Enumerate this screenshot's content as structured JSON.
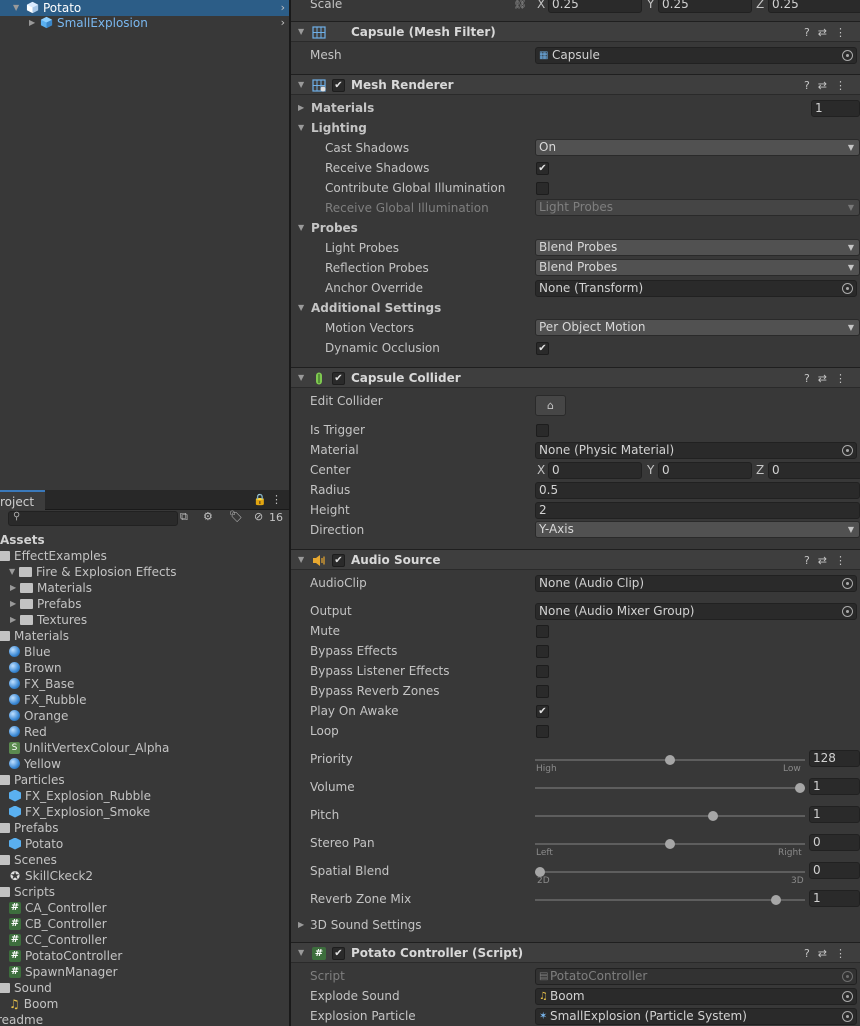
{
  "hierarchy": {
    "items": [
      {
        "label": "Potato",
        "selected": true
      },
      {
        "label": "SmallExplosion",
        "selected": false
      }
    ]
  },
  "project": {
    "tab_label": "roject",
    "hidden_count": "16",
    "search_placeholder": "",
    "assets_root": "Assets",
    "tree": [
      {
        "label": "EffectExamples",
        "icon": "folder-icon",
        "indent": 0,
        "expanded": true
      },
      {
        "label": "Fire & Explosion Effects",
        "icon": "folder-icon",
        "indent": 1,
        "expanded": true
      },
      {
        "label": "Materials",
        "icon": "folder-icon",
        "indent": 2,
        "expanded": false
      },
      {
        "label": "Prefabs",
        "icon": "folder-icon",
        "indent": 2,
        "expanded": false
      },
      {
        "label": "Textures",
        "icon": "folder-icon",
        "indent": 2,
        "expanded": false
      },
      {
        "label": "Materials",
        "icon": "folder-icon",
        "indent": 0,
        "expanded": true
      },
      {
        "label": "Blue",
        "icon": "material-icon",
        "indent": 1
      },
      {
        "label": "Brown",
        "icon": "material-icon",
        "indent": 1
      },
      {
        "label": "FX_Base",
        "icon": "material-icon",
        "indent": 1
      },
      {
        "label": "FX_Rubble",
        "icon": "material-icon",
        "indent": 1
      },
      {
        "label": "Orange",
        "icon": "material-icon",
        "indent": 1
      },
      {
        "label": "Red",
        "icon": "material-icon",
        "indent": 1
      },
      {
        "label": "UnlitVertexColour_Alpha",
        "icon": "shader-icon",
        "indent": 1
      },
      {
        "label": "Yellow",
        "icon": "material-icon",
        "indent": 1
      },
      {
        "label": "Particles",
        "icon": "folder-icon",
        "indent": 0,
        "expanded": true
      },
      {
        "label": "FX_Explosion_Rubble",
        "icon": "prefab-icon",
        "indent": 1
      },
      {
        "label": "FX_Explosion_Smoke",
        "icon": "prefab-icon",
        "indent": 1
      },
      {
        "label": "Prefabs",
        "icon": "folder-icon",
        "indent": 0,
        "expanded": true
      },
      {
        "label": "Potato",
        "icon": "prefab-icon",
        "indent": 1
      },
      {
        "label": "Scenes",
        "icon": "folder-icon",
        "indent": 0,
        "expanded": true
      },
      {
        "label": "SkillCkeck2",
        "icon": "scene-icon",
        "indent": 1
      },
      {
        "label": "Scripts",
        "icon": "folder-icon",
        "indent": 0,
        "expanded": true
      },
      {
        "label": "CA_Controller",
        "icon": "script-icon",
        "indent": 1
      },
      {
        "label": "CB_Controller",
        "icon": "script-icon",
        "indent": 1
      },
      {
        "label": "CC_Controller",
        "icon": "script-icon",
        "indent": 1
      },
      {
        "label": "PotatoController",
        "icon": "script-icon",
        "indent": 1
      },
      {
        "label": "SpawnManager",
        "icon": "script-icon",
        "indent": 1
      },
      {
        "label": "Sound",
        "icon": "folder-icon",
        "indent": 0,
        "expanded": true
      },
      {
        "label": "Boom",
        "icon": "audio-icon",
        "indent": 1
      },
      {
        "label": "readme",
        "icon": "none",
        "indent": 0
      }
    ]
  },
  "inspector": {
    "scale": {
      "label": "Scale",
      "x": "0.25",
      "y": "0.25",
      "z": "0.25",
      "ax": "X",
      "ay": "Y",
      "az": "Z"
    },
    "mesh_filter": {
      "title": "Capsule (Mesh Filter)",
      "mesh_label": "Mesh",
      "mesh_value": "Capsule"
    },
    "mesh_renderer": {
      "title": "Mesh Renderer",
      "materials_label": "Materials",
      "materials_count": "1",
      "lighting_label": "Lighting",
      "cast_shadows_label": "Cast Shadows",
      "cast_shadows_value": "On",
      "receive_shadows_label": "Receive Shadows",
      "contribute_gi_label": "Contribute Global Illumination",
      "receive_gi_label": "Receive Global Illumination",
      "receive_gi_value": "Light Probes",
      "probes_label": "Probes",
      "light_probes_label": "Light Probes",
      "light_probes_value": "Blend Probes",
      "reflection_probes_label": "Reflection Probes",
      "reflection_probes_value": "Blend Probes",
      "anchor_override_label": "Anchor Override",
      "anchor_override_value": "None (Transform)",
      "additional_label": "Additional Settings",
      "motion_vectors_label": "Motion Vectors",
      "motion_vectors_value": "Per Object Motion",
      "dynamic_occlusion_label": "Dynamic Occlusion"
    },
    "capsule_collider": {
      "title": "Capsule Collider",
      "edit_collider_label": "Edit Collider",
      "is_trigger_label": "Is Trigger",
      "material_label": "Material",
      "material_value": "None (Physic Material)",
      "center_label": "Center",
      "cx": "0",
      "cy": "0",
      "cz": "0",
      "radius_label": "Radius",
      "radius_value": "0.5",
      "height_label": "Height",
      "height_value": "2",
      "direction_label": "Direction",
      "direction_value": "Y-Axis"
    },
    "audio_source": {
      "title": "Audio Source",
      "audioclip_label": "AudioClip",
      "audioclip_value": "None (Audio Clip)",
      "output_label": "Output",
      "output_value": "None (Audio Mixer Group)",
      "mute_label": "Mute",
      "bypass_effects_label": "Bypass Effects",
      "bypass_listener_label": "Bypass Listener Effects",
      "bypass_reverb_label": "Bypass Reverb Zones",
      "play_on_awake_label": "Play On Awake",
      "loop_label": "Loop",
      "priority_label": "Priority",
      "priority_value": "128",
      "priority_frac": 0.5,
      "priority_low_label": "High",
      "priority_high_label": "Low",
      "volume_label": "Volume",
      "volume_value": "1",
      "volume_frac": 1.0,
      "pitch_label": "Pitch",
      "pitch_value": "1",
      "pitch_frac": 0.667,
      "stereo_pan_label": "Stereo Pan",
      "stereo_pan_value": "0",
      "stereo_pan_frac": 0.5,
      "pan_left_label": "Left",
      "pan_right_label": "Right",
      "spatial_blend_label": "Spatial Blend",
      "spatial_blend_value": "0",
      "spatial_blend_frac": 0.0,
      "blend_2d_label": "2D",
      "blend_3d_label": "3D",
      "reverb_mix_label": "Reverb Zone Mix",
      "reverb_mix_value": "1",
      "reverb_mix_frac": 0.909,
      "sound3d_label": "3D Sound Settings"
    },
    "potato_controller": {
      "title": "Potato Controller (Script)",
      "script_label": "Script",
      "script_value": "PotatoController",
      "explode_sound_label": "Explode Sound",
      "explode_sound_value": "Boom",
      "explosion_particle_label": "Explosion Particle",
      "explosion_particle_value": "SmallExplosion (Particle System)"
    }
  }
}
